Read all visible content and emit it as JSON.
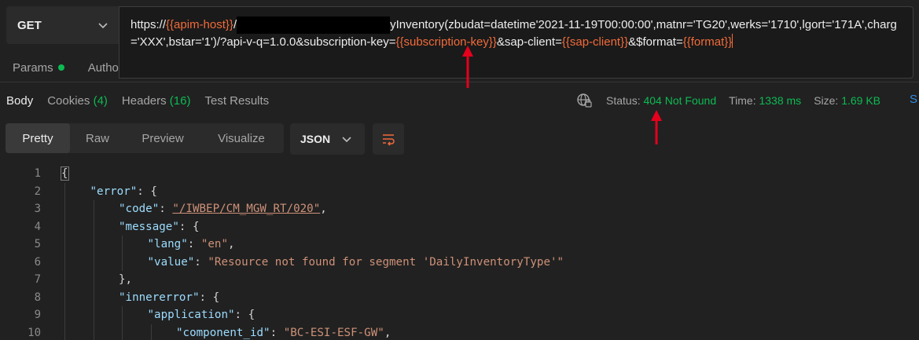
{
  "request": {
    "method": "GET",
    "url": {
      "prefix": "https://",
      "host_var": "{{apim-host}}",
      "slash": "/",
      "after_redact": "yInventory(zbudat=datetime'2021-11-19T00:00:00',matnr='TG20',werks='1710',lgort='171A',charg='XXX',bstar='1')/?api-v-q=1.0.0&subscription-key=",
      "sub_var": "{{subscription-key}}",
      "mid": "&sap-client=",
      "client_var": "{{sap-client}}",
      "mid2": "&$format=",
      "format_var": "{{format}}"
    },
    "tabs": [
      {
        "label": "Params"
      },
      {
        "label": "Autho"
      }
    ]
  },
  "response": {
    "tabs": [
      {
        "label": "Body",
        "count": ""
      },
      {
        "label": "Cookies",
        "count": "(4)"
      },
      {
        "label": "Headers",
        "count": "(16)"
      },
      {
        "label": "Test Results",
        "count": ""
      }
    ],
    "status_label": "Status:",
    "status_value": "404 Not Found",
    "time_label": "Time:",
    "time_value": "1338 ms",
    "size_label": "Size:",
    "size_value": "1.69 KB",
    "cut_text": "S"
  },
  "view": {
    "modes": [
      "Pretty",
      "Raw",
      "Preview",
      "Visualize"
    ],
    "format": "JSON"
  },
  "code_lines": [
    {
      "n": "1",
      "indent": 0,
      "parts": [
        [
          "p",
          "{"
        ]
      ]
    },
    {
      "n": "2",
      "indent": 1,
      "parts": [
        [
          "k",
          "\"error\""
        ],
        [
          "p",
          ": {"
        ]
      ]
    },
    {
      "n": "3",
      "indent": 2,
      "parts": [
        [
          "k",
          "\"code\""
        ],
        [
          "p",
          ": "
        ],
        [
          "s",
          "\"/IWBEP/CM_MGW_RT/020\""
        ],
        [
          "p",
          ","
        ]
      ]
    },
    {
      "n": "4",
      "indent": 2,
      "parts": [
        [
          "k",
          "\"message\""
        ],
        [
          "p",
          ": {"
        ]
      ]
    },
    {
      "n": "5",
      "indent": 3,
      "parts": [
        [
          "k",
          "\"lang\""
        ],
        [
          "p",
          ": "
        ],
        [
          "s",
          "\"en\""
        ],
        [
          "p",
          ","
        ]
      ]
    },
    {
      "n": "6",
      "indent": 3,
      "parts": [
        [
          "k",
          "\"value\""
        ],
        [
          "p",
          ": "
        ],
        [
          "s",
          "\"Resource not found for segment 'DailyInventoryType'\""
        ]
      ]
    },
    {
      "n": "7",
      "indent": 2,
      "parts": [
        [
          "p",
          "},"
        ]
      ]
    },
    {
      "n": "8",
      "indent": 2,
      "parts": [
        [
          "k",
          "\"innererror\""
        ],
        [
          "p",
          ": {"
        ]
      ]
    },
    {
      "n": "9",
      "indent": 3,
      "parts": [
        [
          "k",
          "\"application\""
        ],
        [
          "p",
          ": {"
        ]
      ]
    },
    {
      "n": "10",
      "indent": 4,
      "parts": [
        [
          "k",
          "\"component_id\""
        ],
        [
          "p",
          ": "
        ],
        [
          "s",
          "\"BC-ESI-ESF-GW\""
        ],
        [
          "p",
          ","
        ]
      ]
    }
  ],
  "colors": {
    "background": "#212121",
    "variable": "#f26b3a",
    "success": "#0cbb52",
    "key": "#9cdcfe",
    "string": "#ce9178",
    "annotation": "#e5001c"
  }
}
